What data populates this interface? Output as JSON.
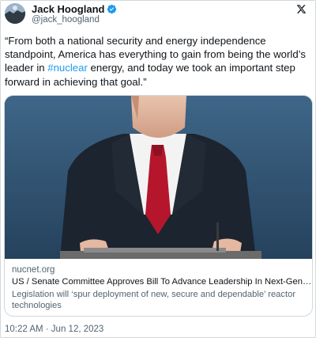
{
  "author": {
    "name": "Jack Hoogland",
    "handle": "@jack_hoogland",
    "avatar": "avatar-image",
    "verified_icon": "verified-badge-icon",
    "verified_color": "#1d9bf0"
  },
  "platform_icon": "x-logo-icon",
  "tweet": {
    "text_before": "“From both a national security and energy independence standpoint, America has everything to gain from being the world’s leader in ",
    "hashtag": "#nuclear",
    "text_after": " energy, and today we took an important step forward in achieving that goal.”",
    "timestamp": "10:22 AM · Jun 12, 2023"
  },
  "card": {
    "image": "senator-at-podium-image",
    "domain": "nucnet.org",
    "title": "US / Senate Committee Approves Bill To Advance Leadership In Next-Generation Nuclear",
    "description": "Legislation will ‘spur deployment of new, secure and dependable’ reactor technologies"
  },
  "colors": {
    "link": "#1d9bf0",
    "secondary_text": "#536471",
    "border": "#cfd9de",
    "image_background": "#2f4f6e"
  }
}
